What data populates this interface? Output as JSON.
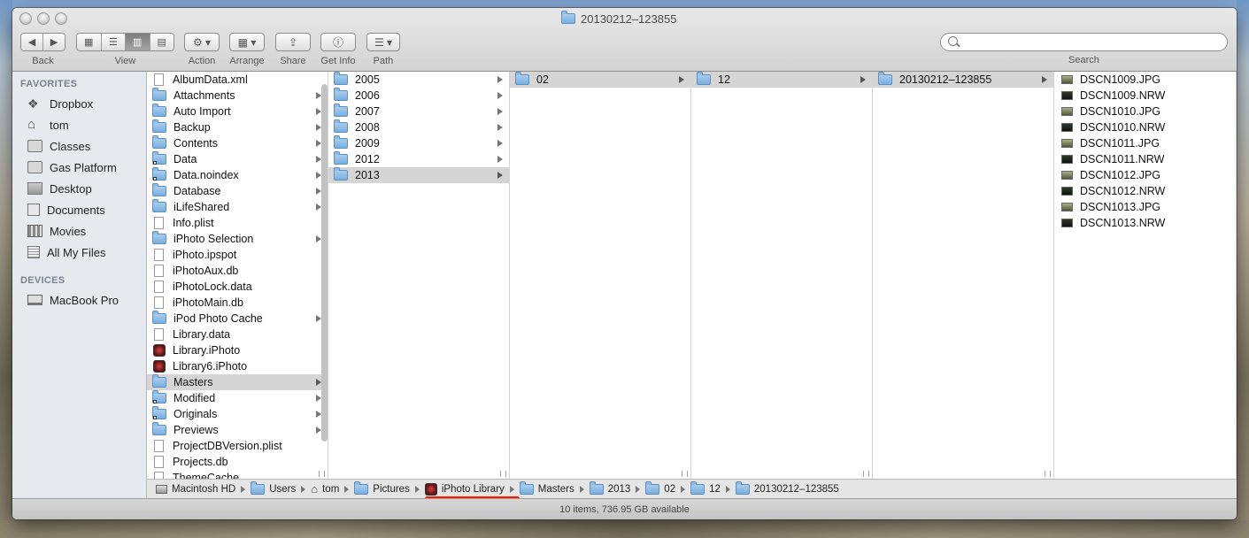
{
  "window": {
    "title": "20130212–123855"
  },
  "toolbar": {
    "back_label": "Back",
    "view_label": "View",
    "action_label": "Action",
    "arrange_label": "Arrange",
    "share_label": "Share",
    "getinfo_label": "Get Info",
    "path_label": "Path",
    "search_label": "Search",
    "search_value": ""
  },
  "sidebar": {
    "favorites_heading": "FAVORITES",
    "devices_heading": "DEVICES",
    "favorites": [
      {
        "label": "Dropbox",
        "icon": "dropbox-icon"
      },
      {
        "label": "tom",
        "icon": "home-icon"
      },
      {
        "label": "Classes",
        "icon": "folder-icon"
      },
      {
        "label": "Gas Platform",
        "icon": "folder-icon"
      },
      {
        "label": "Desktop",
        "icon": "desktop-icon"
      },
      {
        "label": "Documents",
        "icon": "documents-icon"
      },
      {
        "label": "Movies",
        "icon": "movies-icon"
      },
      {
        "label": "All My Files",
        "icon": "all-files-icon"
      }
    ],
    "devices": [
      {
        "label": "MacBook Pro",
        "icon": "laptop-icon"
      }
    ]
  },
  "columns": {
    "col1": [
      {
        "name": "AlbumData.xml"
      },
      {
        "name": "Attachments"
      },
      {
        "name": "Auto Import"
      },
      {
        "name": "Backup"
      },
      {
        "name": "Contents"
      },
      {
        "name": "Data"
      },
      {
        "name": "Data.noindex"
      },
      {
        "name": "Database"
      },
      {
        "name": "iLifeShared"
      },
      {
        "name": "Info.plist"
      },
      {
        "name": "iPhoto Selection"
      },
      {
        "name": "iPhoto.ipspot"
      },
      {
        "name": "iPhotoAux.db"
      },
      {
        "name": "iPhotoLock.data"
      },
      {
        "name": "iPhotoMain.db"
      },
      {
        "name": "iPod Photo Cache"
      },
      {
        "name": "Library.data"
      },
      {
        "name": "Library.iPhoto"
      },
      {
        "name": "Library6.iPhoto"
      },
      {
        "name": "Masters"
      },
      {
        "name": "Modified"
      },
      {
        "name": "Originals"
      },
      {
        "name": "Previews"
      },
      {
        "name": "ProjectDBVersion.plist"
      },
      {
        "name": "Projects.db"
      },
      {
        "name": "ThemeCache"
      }
    ],
    "col2": [
      {
        "name": "2005"
      },
      {
        "name": "2006"
      },
      {
        "name": "2007"
      },
      {
        "name": "2008"
      },
      {
        "name": "2009"
      },
      {
        "name": "2012"
      },
      {
        "name": "2013"
      }
    ],
    "col3": [
      {
        "name": "02"
      }
    ],
    "col4": [
      {
        "name": "12"
      }
    ],
    "col5": [
      {
        "name": "20130212–123855"
      }
    ],
    "col6": [
      {
        "name": "DSCN1009.JPG"
      },
      {
        "name": "DSCN1009.NRW"
      },
      {
        "name": "DSCN1010.JPG"
      },
      {
        "name": "DSCN1010.NRW"
      },
      {
        "name": "DSCN1011.JPG"
      },
      {
        "name": "DSCN1011.NRW"
      },
      {
        "name": "DSCN1012.JPG"
      },
      {
        "name": "DSCN1012.NRW"
      },
      {
        "name": "DSCN1013.JPG"
      },
      {
        "name": "DSCN1013.NRW"
      }
    ]
  },
  "pathbar": [
    {
      "label": "Macintosh HD",
      "icon": "hard-drive-icon"
    },
    {
      "label": "Users",
      "icon": "folder-icon"
    },
    {
      "label": "tom",
      "icon": "home-icon"
    },
    {
      "label": "Pictures",
      "icon": "folder-icon"
    },
    {
      "label": "iPhoto Library",
      "icon": "iphoto-library-icon"
    },
    {
      "label": "Masters",
      "icon": "folder-icon"
    },
    {
      "label": "2013",
      "icon": "folder-icon"
    },
    {
      "label": "02",
      "icon": "folder-icon"
    },
    {
      "label": "12",
      "icon": "folder-icon"
    },
    {
      "label": "20130212–123855",
      "icon": "folder-icon"
    }
  ],
  "status": {
    "text": "10 items, 736.95 GB available"
  },
  "colors": {
    "annotation_underline": "#ff1a00",
    "selection": "#d5d5d5"
  }
}
